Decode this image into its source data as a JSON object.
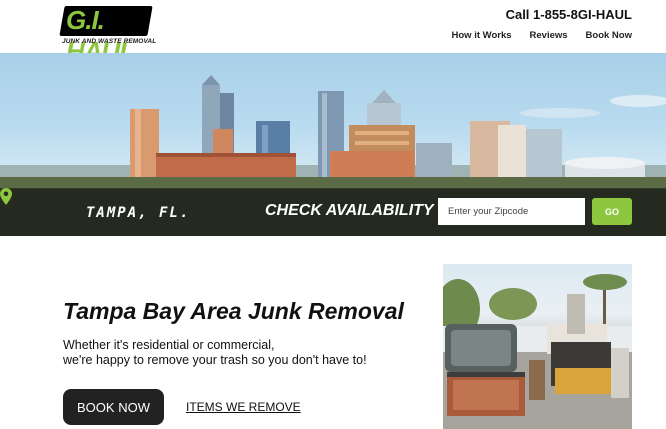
{
  "header": {
    "logo_text": "G.I. HAUL",
    "logo_tagline": "JUNK AND WASTE REMOVAL",
    "phone": "Call 1-855-8GI-HAUL",
    "nav": [
      "How it Works",
      "Reviews",
      "Book Now"
    ]
  },
  "hero": {
    "city": "TAMPA, FL.",
    "cta": "CHECK AVAILABILITY",
    "zip_placeholder": "Enter your Zipcode",
    "go_label": "GO"
  },
  "main": {
    "headline": "Tampa Bay Area Junk Removal",
    "subtext_line1": "Whether it's residential or commercial,",
    "subtext_line2": "we're happy to remove your trash so you don't have to!",
    "book_label": "BOOK NOW",
    "items_label": "ITEMS WE REMOVE"
  },
  "colors": {
    "brand_green": "#8dc63f",
    "dark_button": "#222222"
  },
  "icons": [
    "location-pin-icon",
    "star-icon"
  ]
}
